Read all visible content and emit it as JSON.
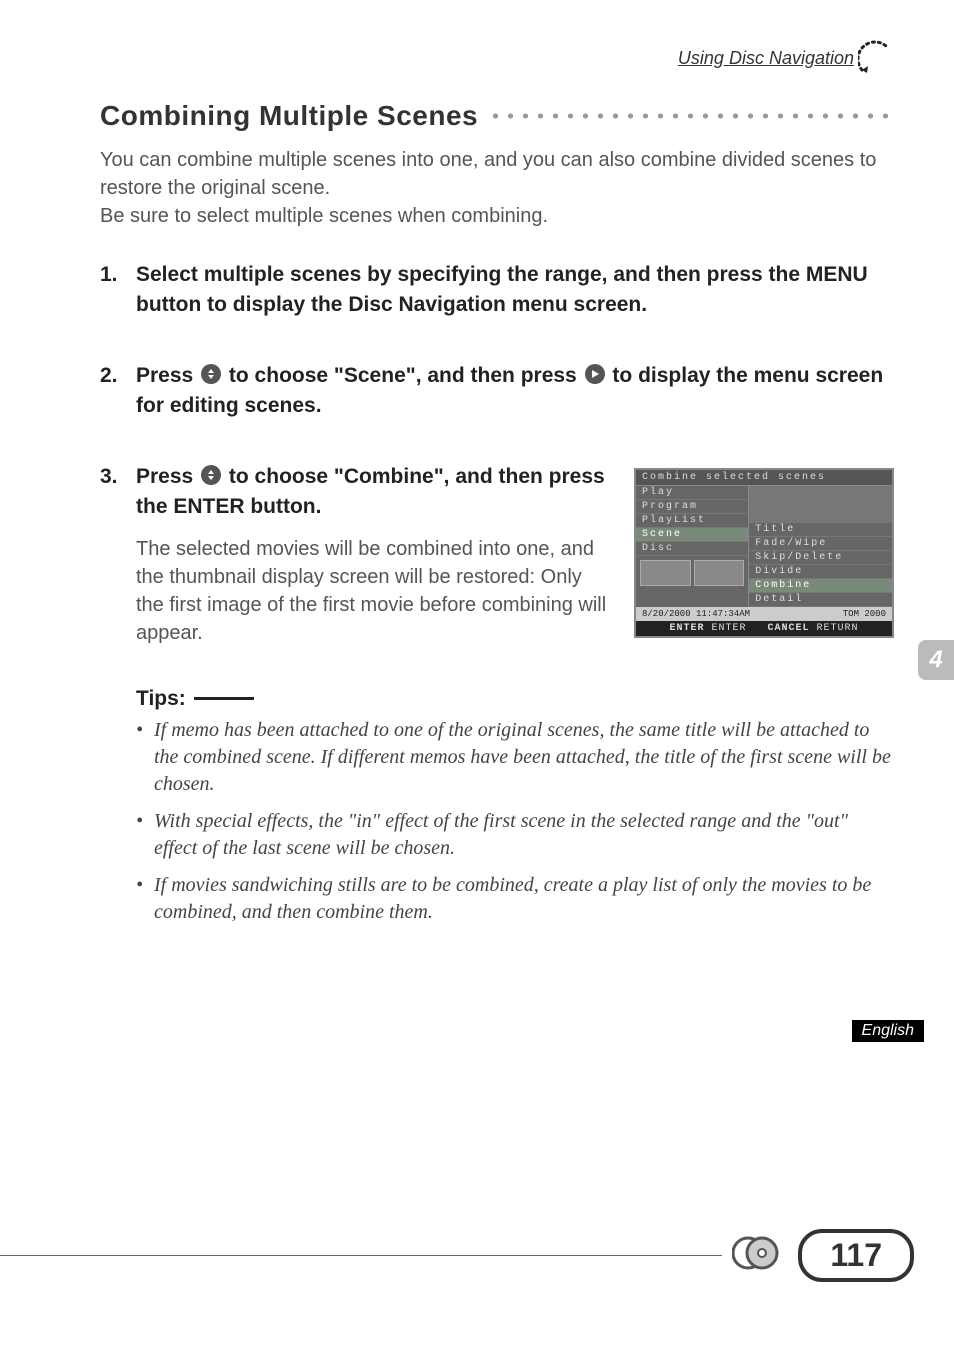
{
  "header": {
    "section": "Using Disc Navigation"
  },
  "title": "Combining Multiple Scenes",
  "intro_line1": "You can combine multiple scenes into one, and you can also combine divided scenes to restore the original scene.",
  "intro_line2": "Be sure to select multiple scenes when combining.",
  "steps": {
    "s1_num": "1.",
    "s1_text": "Select multiple scenes by specifying the range, and then press the MENU button to display the Disc Navigation menu screen.",
    "s2_num": "2.",
    "s2_pre": "Press ",
    "s2_mid": " to choose \"Scene\", and then press ",
    "s2_post": " to display the menu screen for editing scenes.",
    "s3_num": "3.",
    "s3_pre": "Press ",
    "s3_post": " to choose \"Combine\", and then press the ENTER button.",
    "s3_body": "The selected movies will be combined into one, and the thumbnail display screen will be restored: Only the first image of the first movie before combining will appear."
  },
  "screenshot": {
    "title": "Combine selected scenes",
    "left_items": [
      "Play",
      "Program",
      "PlayList",
      "Scene",
      "Disc"
    ],
    "right_items": [
      "Title",
      "Fade/Wipe",
      "Skip/Delete",
      "Divide",
      "Combine",
      "Detail"
    ],
    "highlight_left": "Scene",
    "highlight_right": "Combine",
    "status_date": "8/20/2000 11:47:34AM",
    "status_right": "TOM 2000",
    "footer_enter_label": "ENTER",
    "footer_enter_action": "ENTER",
    "footer_cancel_label": "CANCEL",
    "footer_cancel_action": "RETURN"
  },
  "tips": {
    "label": "Tips:",
    "items": [
      "If memo has been attached to one of the original scenes, the same title will be attached to the combined scene. If different memos have been attached, the title of the first scene will be chosen.",
      "With special effects, the \"in\" effect of the first scene in the selected range and the \"out\" effect of the last scene will be chosen.",
      "If movies sandwiching stills are to be combined, create a play list of only the movies to be combined, and then combine them."
    ]
  },
  "side_tab": "4",
  "language": "English",
  "page_number": "117",
  "icons": {
    "joystick_updown": "joystick-updown-icon",
    "joystick_right": "joystick-right-icon"
  }
}
